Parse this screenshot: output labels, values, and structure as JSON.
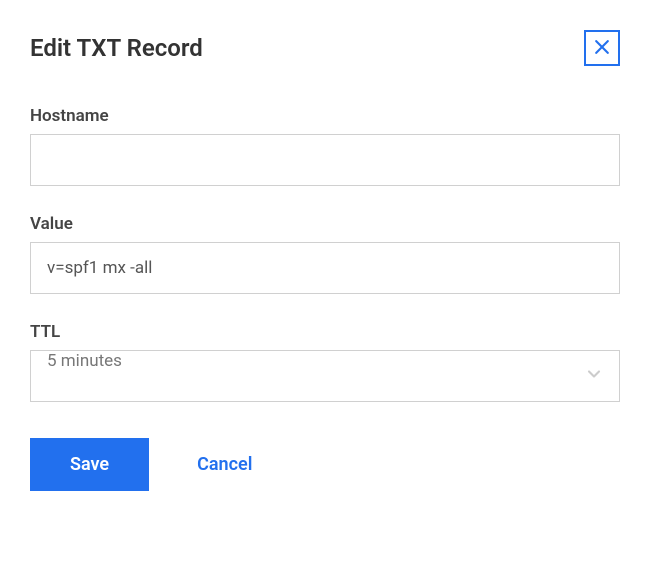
{
  "dialog": {
    "title": "Edit TXT Record"
  },
  "fields": {
    "hostname": {
      "label": "Hostname",
      "value": ""
    },
    "value": {
      "label": "Value",
      "value": "v=spf1 mx -all"
    },
    "ttl": {
      "label": "TTL",
      "selected": "5 minutes"
    }
  },
  "buttons": {
    "save": "Save",
    "cancel": "Cancel"
  },
  "colors": {
    "accent": "#2270ee"
  }
}
